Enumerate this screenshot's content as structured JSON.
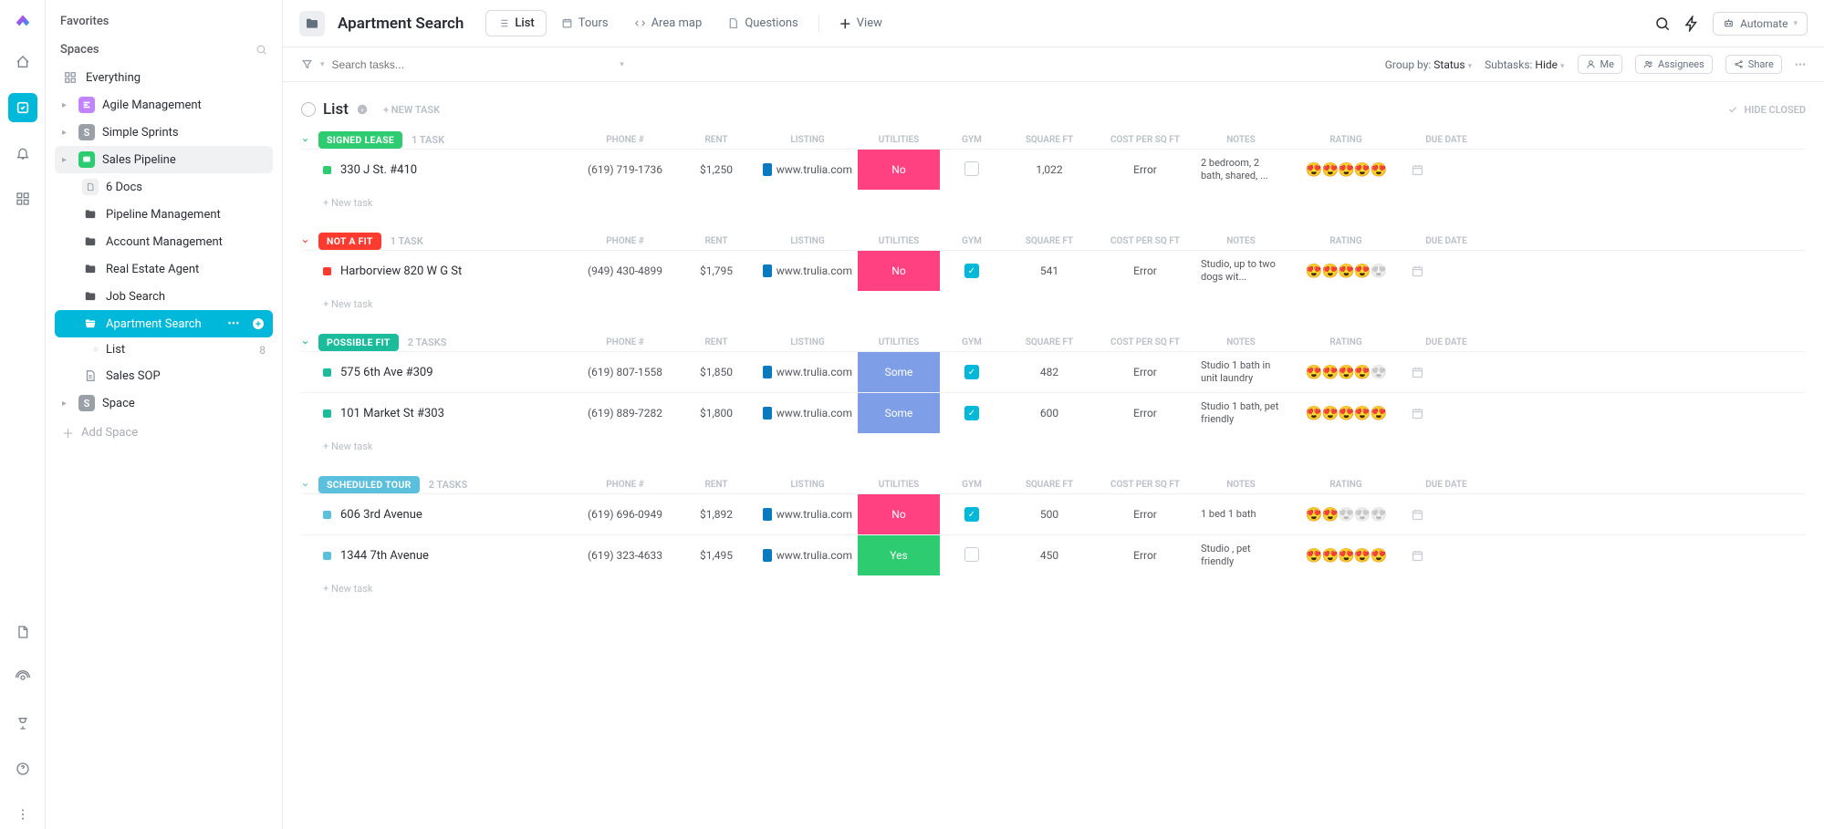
{
  "rail": {},
  "sidebar": {
    "favorites": "Favorites",
    "spaces": "Spaces",
    "everything": "Everything",
    "items": [
      {
        "label": "Agile Management",
        "iconBg": "#c084fc",
        "iconText": "A"
      },
      {
        "label": "Simple Sprints",
        "iconBg": "#9aa0a8",
        "iconText": "S"
      },
      {
        "label": "Sales Pipeline",
        "iconBg": "#2ecc71",
        "iconText": ""
      },
      {
        "label": "6 Docs"
      },
      {
        "label": "Pipeline Management"
      },
      {
        "label": "Account Management"
      },
      {
        "label": "Real Estate Agent"
      },
      {
        "label": "Job Search"
      },
      {
        "label": "Apartment Search"
      },
      {
        "label": "List",
        "count": "8"
      },
      {
        "label": "Sales SOP"
      },
      {
        "label": "Space",
        "iconBg": "#9aa0a8",
        "iconText": "S"
      }
    ],
    "addSpace": "Add Space"
  },
  "header": {
    "title": "Apartment Search",
    "views": [
      {
        "label": "List"
      },
      {
        "label": "Tours"
      },
      {
        "label": "Area map"
      },
      {
        "label": "Questions"
      },
      {
        "label": "View"
      }
    ],
    "automate": "Automate"
  },
  "filterbar": {
    "searchPlaceholder": "Search tasks...",
    "groupBy": "Group by:",
    "groupByValue": "Status",
    "subtasks": "Subtasks:",
    "subtasksValue": "Hide",
    "me": "Me",
    "assignees": "Assignees",
    "share": "Share"
  },
  "listHeader": {
    "title": "List",
    "newTask": "+ NEW TASK",
    "hideClosed": "HIDE CLOSED"
  },
  "columns": [
    "PHONE #",
    "RENT",
    "LISTING",
    "UTILITIES",
    "GYM",
    "SQUARE FT",
    "COST PER SQ FT",
    "NOTES",
    "RATING",
    "DUE DATE"
  ],
  "groups": [
    {
      "status": "SIGNED LEASE",
      "color": "#2ecc71",
      "chevColor": "#2ecc71",
      "count": "1 TASK",
      "tasks": [
        {
          "name": "330 J St. #410",
          "dot": "#2ecc71",
          "phone": "(619) 719-1736",
          "rent": "$1,250",
          "listing": "www.trulia.com",
          "util": "No",
          "utilClass": "util-no",
          "gym": false,
          "sqft": "1,022",
          "cost": "Error",
          "notes": "2 bedroom, 2 bath, shared, ...",
          "rating": 5
        }
      ]
    },
    {
      "status": "NOT A FIT",
      "color": "#ff3b30",
      "chevColor": "#ff3b30",
      "count": "1 TASK",
      "tasks": [
        {
          "name": "Harborview 820 W G St",
          "dot": "#ff3b30",
          "phone": "(949) 430-4899",
          "rent": "$1,795",
          "listing": "www.trulia.com",
          "util": "No",
          "utilClass": "util-no",
          "gym": true,
          "sqft": "541",
          "cost": "Error",
          "notes": "Studio, up to two dogs wit...",
          "rating": 4
        }
      ]
    },
    {
      "status": "POSSIBLE FIT",
      "color": "#1abc9c",
      "chevColor": "#1abc9c",
      "count": "2 TASKS",
      "tasks": [
        {
          "name": "575 6th Ave #309",
          "dot": "#1abc9c",
          "phone": "(619) 807-1558",
          "rent": "$1,850",
          "listing": "www.trulia.com",
          "util": "Some",
          "utilClass": "util-some",
          "gym": true,
          "sqft": "482",
          "cost": "Error",
          "notes": "Studio 1 bath in unit laundry",
          "rating": 4
        },
        {
          "name": "101 Market St #303",
          "dot": "#1abc9c",
          "phone": "(619) 889-7282",
          "rent": "$1,800",
          "listing": "www.trulia.com",
          "util": "Some",
          "utilClass": "util-some",
          "gym": true,
          "sqft": "600",
          "cost": "Error",
          "notes": "Studio 1 bath, pet friendly",
          "rating": 5
        }
      ]
    },
    {
      "status": "SCHEDULED TOUR",
      "color": "#5bc0de",
      "chevColor": "#5bc0de",
      "count": "2 TASKS",
      "tasks": [
        {
          "name": "606 3rd Avenue",
          "dot": "#5bc0de",
          "phone": "(619) 696-0949",
          "rent": "$1,892",
          "listing": "www.trulia.com",
          "util": "No",
          "utilClass": "util-no",
          "gym": true,
          "sqft": "500",
          "cost": "Error",
          "notes": "1 bed 1 bath",
          "rating": 2
        },
        {
          "name": "1344 7th Avenue",
          "dot": "#5bc0de",
          "phone": "(619) 323-4633",
          "rent": "$1,495",
          "listing": "www.trulia.com",
          "util": "Yes",
          "utilClass": "util-yes",
          "gym": false,
          "sqft": "450",
          "cost": "Error",
          "notes": "Studio , pet friendly",
          "rating": 5
        }
      ]
    }
  ],
  "newTaskLink": "+ New task"
}
